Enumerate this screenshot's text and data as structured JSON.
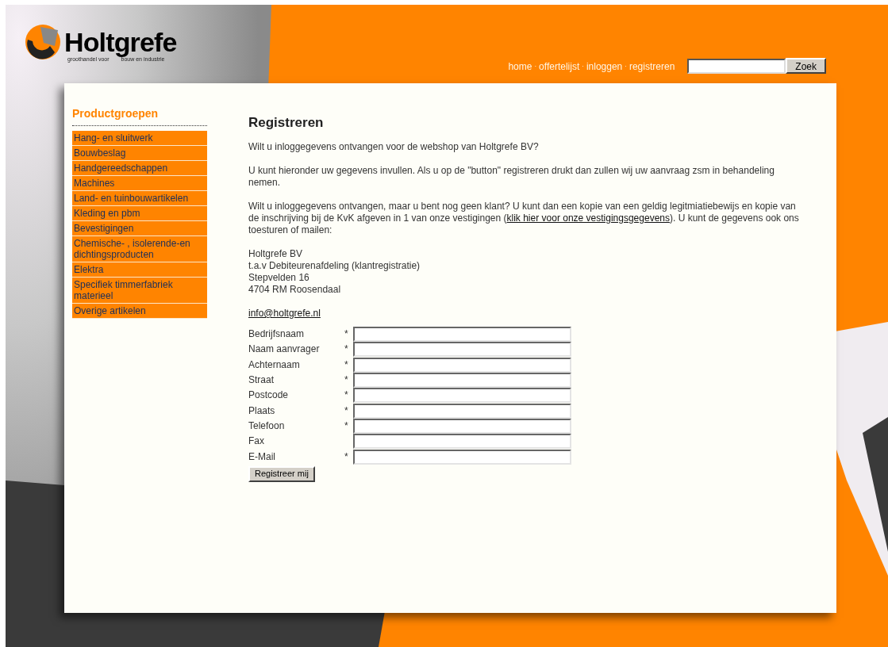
{
  "logo": {
    "name": "Holtgrefe",
    "tagline": [
      "groothandel voor",
      "bouw en industrie"
    ]
  },
  "nav": {
    "links": [
      "home",
      "offertelijst",
      "inloggen",
      "registreren"
    ],
    "separator": "·"
  },
  "search": {
    "button": "Zoek"
  },
  "sidebar": {
    "title": "Productgroepen",
    "items": [
      "Hang- en sluitwerk",
      "Bouwbeslag",
      "Handgereedschappen",
      "Machines",
      "Land- en tuinbouwartikelen",
      "Kleding en pbm",
      "Bevestigingen",
      "Chemische- , isolerende-en dichtingsproducten",
      "Elektra",
      "Specifiek timmerfabriek materieel",
      "Overige artikelen"
    ]
  },
  "content": {
    "title": "Registreren",
    "intro": "Wilt u inloggegevens ontvangen voor de webshop van Holtgrefe BV?",
    "instructions": "U kunt hieronder uw gegevens invullen. Als u op de \"button\" registreren drukt dan zullen wij uw aanvraag zsm in behandeling nemen.",
    "notice": {
      "before": "Wilt u inloggegevens ontvangen, maar u bent nog geen klant? U kunt dan een kopie van een geldig legitmiatiebewijs en kopie van de inschrijving bij de KvK afgeven in 1 van onze vestigingen (",
      "link": "klik hier voor onze vestigingsgegevens",
      "after": "). U kunt de gegevens ook ons toesturen of mailen:"
    },
    "address": [
      "Holtgrefe BV",
      "t.a.v Debiteurenafdeling (klantregistratie)",
      "Stepvelden 16",
      "4704 RM Roosendaal"
    ],
    "email": "info@holtgrefe.nl",
    "fields": [
      {
        "label": "Bedrijfsnaam",
        "marker": "*"
      },
      {
        "label": "Naam aanvrager",
        "marker": "*"
      },
      {
        "label": "Achternaam",
        "marker": "*"
      },
      {
        "label": "Straat",
        "marker": "*"
      },
      {
        "label": "Postcode",
        "marker": "*"
      },
      {
        "label": "Plaats",
        "marker": "*"
      },
      {
        "label": "Telefoon",
        "marker": "*"
      },
      {
        "label": "Fax"
      },
      {
        "label": "E-Mail",
        "marker": "*"
      }
    ],
    "submit": "Registreer mij"
  }
}
